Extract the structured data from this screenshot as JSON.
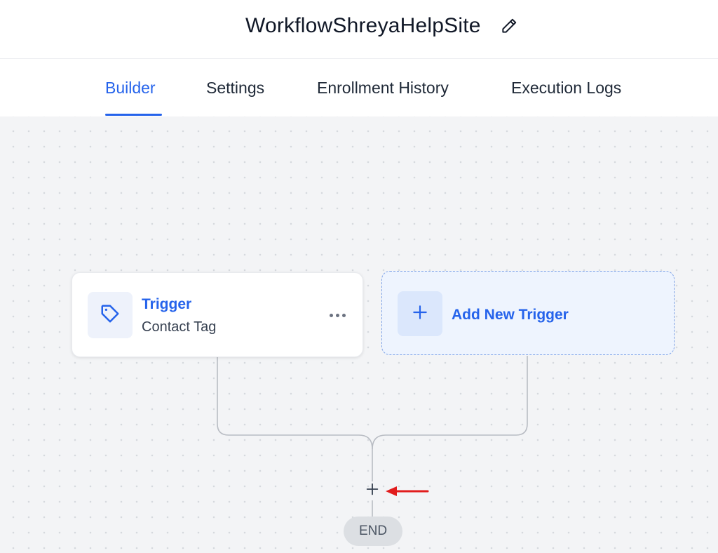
{
  "header": {
    "title": "WorkflowShreyaHelpSite",
    "edit_icon": "pencil-icon"
  },
  "tabs": [
    {
      "label": "Builder",
      "active": true
    },
    {
      "label": "Settings",
      "active": false
    },
    {
      "label": "Enrollment History",
      "active": false
    },
    {
      "label": "Execution Logs",
      "active": false
    }
  ],
  "canvas": {
    "trigger_card": {
      "icon": "tag-icon",
      "title": "Trigger",
      "subtitle": "Contact Tag",
      "menu_icon": "more-horizontal-icon"
    },
    "add_trigger": {
      "icon": "plus-icon",
      "label": "Add New Trigger"
    },
    "add_step_icon": "plus-icon",
    "end_label": "END",
    "annotation": "red-arrow-icon"
  },
  "colors": {
    "accent": "#2563eb",
    "canvas_bg": "#f3f4f6",
    "add_card_bg": "#eef4fe",
    "annotation_red": "#e11d1d",
    "end_pill_bg": "#dcdfe3"
  }
}
